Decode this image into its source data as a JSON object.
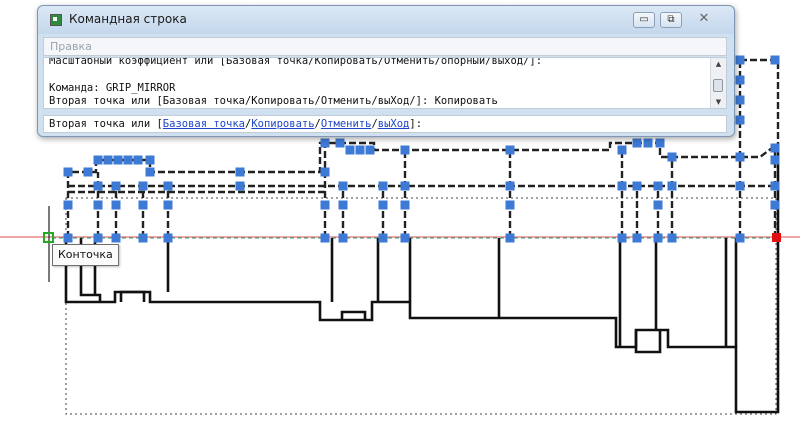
{
  "window": {
    "title": "Командная строка",
    "buttons": {
      "minimize": "▭",
      "restore": "⧉",
      "close": "✕"
    }
  },
  "menu": {
    "item": "Правка"
  },
  "history": {
    "lines": [
      "Масштабный коэффициент или [Базовая точка/Копировать/Отменить/опорный/выход/]:",
      "",
      "Команда: GRIP_MIRROR",
      "Вторая точка или [Базовая точка/Копировать/Отменить/выХод/]: Копировать"
    ]
  },
  "prompt": {
    "prefix": "Вторая точка или [",
    "options": [
      "Базовая точка",
      "Копировать",
      "Отменить",
      "выХод"
    ],
    "separator": "/",
    "suffix": "]:"
  },
  "snap_tooltip": "Конточка",
  "colors": {
    "grip": "#3d7ad6",
    "grip_hot": "#e01010",
    "snap_marker": "#22aa22",
    "mirror_line": "#e07070",
    "centerline": "#2a9a8a",
    "link": "#1d46c8"
  },
  "icons": {
    "app": "command-line-icon",
    "scroll_up": "▲",
    "scroll_down": "▼"
  }
}
